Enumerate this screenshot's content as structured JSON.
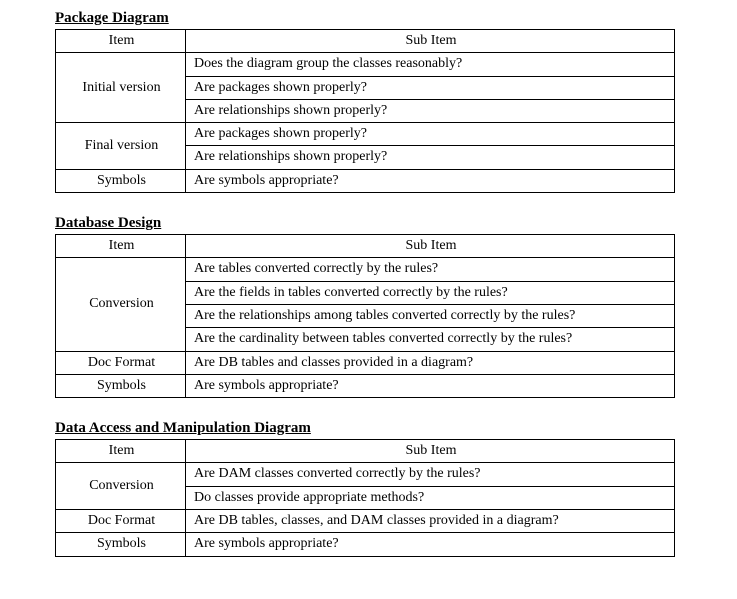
{
  "sections": [
    {
      "title": "Package Diagram",
      "header_item": "Item",
      "header_sub": "Sub Item",
      "groups": [
        {
          "item": "Initial version",
          "subs": [
            "Does the diagram group the classes reasonably?",
            "Are packages shown properly?",
            "Are relationships shown properly?"
          ]
        },
        {
          "item": "Final version",
          "subs": [
            "Are packages shown properly?",
            "Are relationships shown properly?"
          ]
        },
        {
          "item": "Symbols",
          "subs": [
            "Are symbols appropriate?"
          ]
        }
      ]
    },
    {
      "title": "Database Design",
      "header_item": "Item",
      "header_sub": "Sub Item",
      "groups": [
        {
          "item": "Conversion",
          "subs": [
            "Are tables converted correctly by the rules?",
            "Are the fields in tables converted correctly by the rules?",
            "Are the relationships among tables converted correctly by the rules?",
            "Are the cardinality between tables converted correctly by the rules?"
          ]
        },
        {
          "item": "Doc Format",
          "subs": [
            "Are DB tables and classes provided in a diagram?"
          ]
        },
        {
          "item": "Symbols",
          "subs": [
            "Are symbols appropriate?"
          ]
        }
      ]
    },
    {
      "title": "Data Access and Manipulation Diagram",
      "header_item": "Item",
      "header_sub": "Sub Item",
      "groups": [
        {
          "item": "Conversion",
          "subs": [
            "Are DAM classes converted correctly by the rules?",
            "Do classes provide appropriate methods?"
          ]
        },
        {
          "item": "Doc Format",
          "subs": [
            "Are DB tables, classes, and DAM classes provided in a diagram?"
          ]
        },
        {
          "item": "Symbols",
          "subs": [
            "Are symbols appropriate?"
          ]
        }
      ]
    }
  ]
}
